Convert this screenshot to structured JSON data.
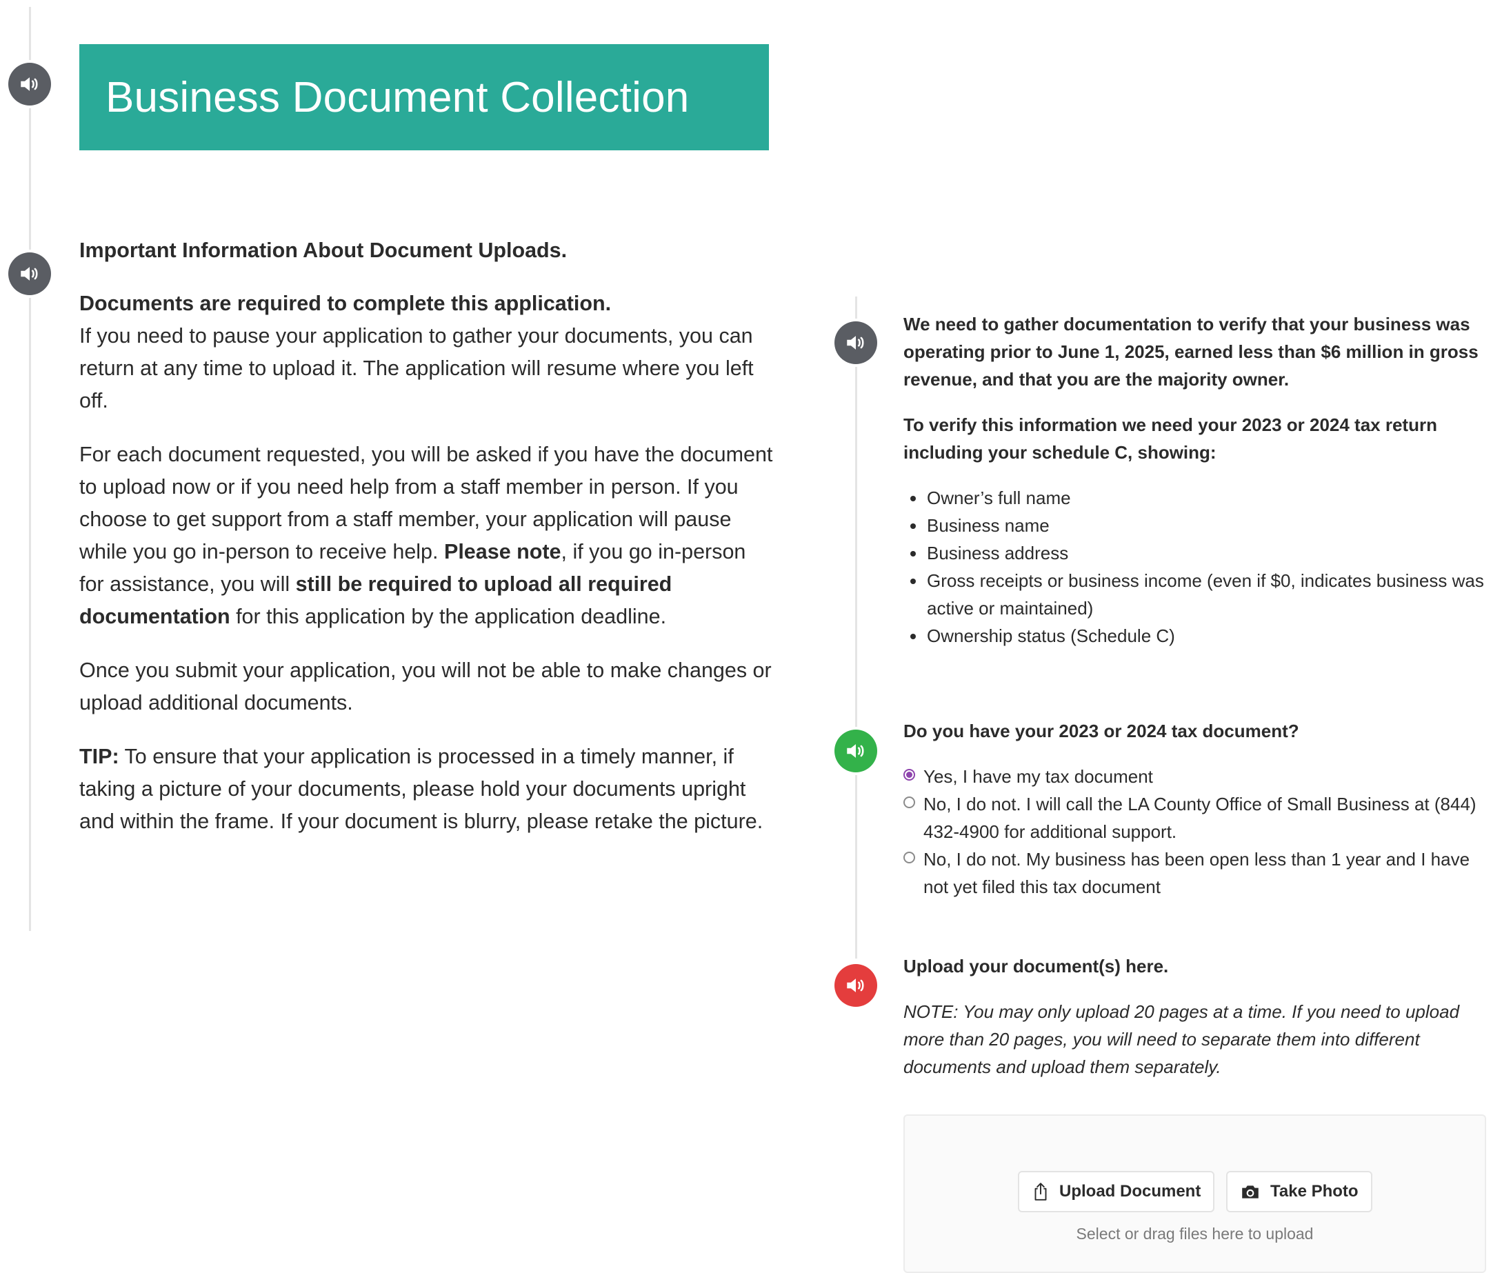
{
  "title": "Business Document Collection",
  "info": {
    "heading": "Important Information About Document Uploads.",
    "required_lead": "Documents are required to complete this application.",
    "pause_text": "If you need to pause your application to gather your documents, you can return at any time to upload it. The application will resume where you left off.",
    "para2_a": "For each document requested, you will be asked if you have the document to upload now or if you need help from a staff member in person. If you choose to get support from a staff member, your application will pause while you go in-person to receive help. ",
    "para2_b": "Please note",
    "para2_c": ", if you go in-person for assistance, you will ",
    "para2_d": "still be required to upload all required documentation",
    "para2_e": " for this application by the application deadline.",
    "para3": "Once you submit your application, you will not be able to make changes or upload additional documents.",
    "tip_label": "TIP:",
    "tip_text": " To ensure that your application is processed in a timely manner, if taking a picture of your documents, please hold your documents upright and within the frame. If your document is blurry, please retake the picture."
  },
  "verify": {
    "intro": "We need to gather documentation to verify that your business was operating prior to June 1, 2025, earned less than $6 million in gross revenue, and that you are the majority owner.",
    "need": "To verify this information we need your 2023 or 2024 tax return including your schedule C, showing:",
    "items": [
      "Owner’s full name",
      "Business name",
      "Business address",
      "Gross receipts or business income (even if $0, indicates business was active or maintained)",
      "Ownership status (Schedule C)"
    ]
  },
  "question": {
    "label": "Do you have your 2023 or 2024 tax document?",
    "options": [
      "Yes, I have my tax document",
      "No, I do not. I will call the LA County Office of Small Business at (844) 432-4900 for additional support.",
      "No, I do not. My business has been open less than 1 year and I have not yet filed this tax document"
    ],
    "selected_index": 0
  },
  "upload": {
    "label": "Upload your document(s) here.",
    "note": "NOTE: You may only upload 20 pages at a time. If you need to upload more than 20 pages, you will need to separate them into different documents and upload them separately.",
    "upload_button": "Upload Document",
    "photo_button": "Take Photo",
    "hint": "Select or drag files here to upload"
  },
  "icons": {
    "read_aloud": "speaker-icon",
    "upload": "share-upload-icon",
    "photo": "camera-icon"
  },
  "colors": {
    "banner": "#2aaa98",
    "speaker_default": "#5a5d63",
    "speaker_question": "#33b24a",
    "speaker_upload": "#e43d3d",
    "radio_selected": "#8e44ad"
  }
}
